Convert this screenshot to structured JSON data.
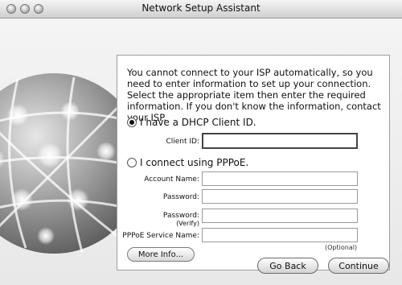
{
  "window": {
    "title": "Network Setup Assistant"
  },
  "panel": {
    "message": "You cannot connect to your ISP automatically, so you need to enter information to set up your connection. Select the appropriate item then enter the required information. If you don't know the information, contact your ISP.",
    "dhcp": {
      "label": "I have a DHCP Client ID.",
      "selected": true
    },
    "client_id": {
      "label": "Client ID:",
      "value": ""
    },
    "pppoe": {
      "label": "I connect using PPPoE.",
      "selected": false
    },
    "account_name": {
      "label": "Account Name:",
      "value": ""
    },
    "password": {
      "label": "Password:",
      "value": ""
    },
    "password_verify": {
      "label": "Password:",
      "sublabel": "(Verify)",
      "value": ""
    },
    "service_name": {
      "label": "PPPoE Service Name:",
      "value": "",
      "note": "(Optional)"
    },
    "more_info_label": "More Info..."
  },
  "footer": {
    "back_label": "Go Back",
    "continue_label": "Continue"
  }
}
